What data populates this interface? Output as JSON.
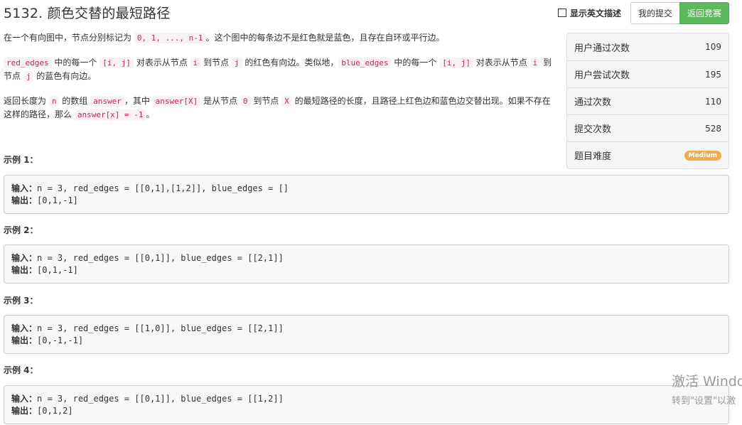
{
  "problem": {
    "title": "5132. 颜色交替的最短路径"
  },
  "toolbar": {
    "toggle_label": "显示英文描述",
    "my_submissions": "我的提交",
    "back_to_contest": "返回竞赛"
  },
  "description": {
    "p1": {
      "t1": "在一个有向图中，节点分别标记为 ",
      "c1": "0, 1, ..., n-1",
      "t2": "。这个图中的每条边不是红色就是蓝色，且存在自环或平行边。"
    },
    "p2": {
      "c1": "red_edges",
      "t1": " 中的每一个 ",
      "c2": "[i, j]",
      "t2": " 对表示从节点 ",
      "c3": "i",
      "t3": " 到节点 ",
      "c4": "j",
      "t4": " 的红色有向边。类似地，",
      "c5": "blue_edges",
      "t5": " 中的每一个 ",
      "c6": "[i, j]",
      "t6": " 对表示从节点 ",
      "c7": "i",
      "t7": " 到节点 ",
      "c8": "j",
      "t8": " 的蓝色有向边。"
    },
    "p3": {
      "t1": "返回长度为 ",
      "c1": "n",
      "t2": " 的数组 ",
      "c2": "answer",
      "t3": "，其中 ",
      "c3": "answer[X]",
      "t4": " 是从节点 ",
      "c4": "0",
      "t5": " 到节点 ",
      "c5": "X",
      "t6": " 的最短路径的长度，且路径上红色边和蓝色边交替出现。如果不存在这样的路径，那么 ",
      "c6": "answer[x] = -1",
      "t7": "。"
    }
  },
  "stats": [
    {
      "label": "用户通过次数",
      "value": "109"
    },
    {
      "label": "用户尝试次数",
      "value": "195"
    },
    {
      "label": "通过次数",
      "value": "110"
    },
    {
      "label": "提交次数",
      "value": "528"
    },
    {
      "label": "题目难度",
      "value": "Medium"
    }
  ],
  "examples": [
    {
      "title": "示例 1：",
      "input_key": "输入：",
      "input": "n = 3, red_edges = [[0,1],[1,2]], blue_edges = []",
      "output_key": "输出：",
      "output": "[0,1,-1]"
    },
    {
      "title": "示例 2：",
      "input_key": "输入：",
      "input": "n = 3, red_edges = [[0,1]], blue_edges = [[2,1]]",
      "output_key": "输出：",
      "output": "[0,1,-1]"
    },
    {
      "title": "示例 3：",
      "input_key": "输入：",
      "input": "n = 3, red_edges = [[1,0]], blue_edges = [[2,1]]",
      "output_key": "输出：",
      "output": "[0,-1,-1]"
    },
    {
      "title": "示例 4：",
      "input_key": "输入：",
      "input": "n = 3, red_edges = [[0,1]], blue_edges = [[1,2]]",
      "output_key": "输出：",
      "output": "[0,1,2]"
    }
  ],
  "watermark": {
    "line1": "激活 Windo",
    "line2": "转到\"设置\"以激"
  },
  "colors": {
    "accent_green": "#5cb85c",
    "medium_badge": "#f0ad4e",
    "code_text": "#c7254e"
  }
}
